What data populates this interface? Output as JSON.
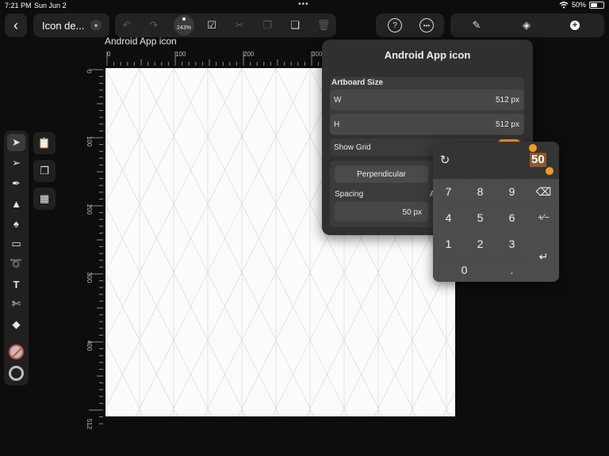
{
  "status_bar": {
    "time": "7:21 PM",
    "date": "Sun Jun 2",
    "battery": "50%",
    "battery_level": 0.5
  },
  "toolbar": {
    "document_title": "Icon de...",
    "zoom": "243%"
  },
  "canvas": {
    "artboard_name": "Android App icon",
    "ruler_top_labels": [
      "0",
      "100",
      "200",
      "300"
    ],
    "ruler_left_labels": [
      "0",
      "100",
      "200",
      "300",
      "400",
      "512"
    ]
  },
  "document_panel": {
    "title": "Android App icon",
    "artboard_size_label": "Artboard Size",
    "width_label": "W",
    "width_value": "512 px",
    "height_label": "H",
    "height_value": "512 px",
    "show_grid_label": "Show Grid",
    "grid_type_selected": "Perpendicular",
    "spacing_label": "Spacing",
    "spacing_value": "50 px",
    "truncated_label": "A"
  },
  "keypad": {
    "entry_value": "50",
    "keys": [
      "7",
      "8",
      "9",
      "4",
      "5",
      "6",
      "1",
      "2",
      "3",
      "0",
      "."
    ],
    "plus_minus": "+∕−"
  },
  "colors": {
    "accent": "#f59a24",
    "panel": "#303030",
    "background": "#0d0d0d"
  }
}
